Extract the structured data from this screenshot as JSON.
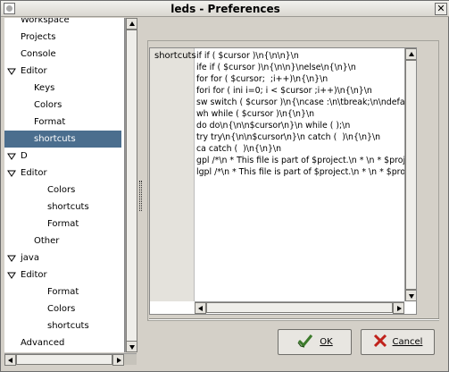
{
  "window": {
    "title": "leds - Preferences"
  },
  "tree": {
    "items": [
      {
        "label": "Workspace",
        "depth": 0,
        "expanded": null,
        "selected": false
      },
      {
        "label": "Projects",
        "depth": 1,
        "expanded": null,
        "selected": false
      },
      {
        "label": "Console",
        "depth": 1,
        "expanded": null,
        "selected": false
      },
      {
        "label": "Editor",
        "depth": 0,
        "expanded": true,
        "selected": false
      },
      {
        "label": "Keys",
        "depth": 2,
        "expanded": null,
        "selected": false
      },
      {
        "label": "Colors",
        "depth": 2,
        "expanded": null,
        "selected": false
      },
      {
        "label": "Format",
        "depth": 2,
        "expanded": null,
        "selected": false
      },
      {
        "label": "shortcuts",
        "depth": 2,
        "expanded": null,
        "selected": true
      },
      {
        "label": "D",
        "depth": 0,
        "expanded": true,
        "selected": false
      },
      {
        "label": "Editor",
        "depth": 1,
        "expanded": true,
        "selected": false
      },
      {
        "label": "Colors",
        "depth": 3,
        "expanded": null,
        "selected": false
      },
      {
        "label": "shortcuts",
        "depth": 3,
        "expanded": null,
        "selected": false
      },
      {
        "label": "Format",
        "depth": 3,
        "expanded": null,
        "selected": false
      },
      {
        "label": "Other",
        "depth": 2,
        "expanded": null,
        "selected": false
      },
      {
        "label": "java",
        "depth": 0,
        "expanded": true,
        "selected": false
      },
      {
        "label": "Editor",
        "depth": 1,
        "expanded": true,
        "selected": false
      },
      {
        "label": "Format",
        "depth": 3,
        "expanded": null,
        "selected": false
      },
      {
        "label": "Colors",
        "depth": 3,
        "expanded": null,
        "selected": false
      },
      {
        "label": "shortcuts",
        "depth": 3,
        "expanded": null,
        "selected": false
      },
      {
        "label": "Advanced",
        "depth": 1,
        "expanded": null,
        "selected": false
      }
    ]
  },
  "shortcuts": {
    "key_label": "shortcuts",
    "lines": [
      "if if ( $cursor )\\n{\\n\\n}\\n",
      "ife if ( $cursor )\\n{\\n\\n}\\nelse\\n{\\n}\\n",
      "for for ( $cursor;  ;i++)\\n{\\n}\\n",
      "fori for ( ini i=0; i < $cursor ;i++)\\n{\\n}\\n",
      "sw switch ( $cursor )\\n{\\ncase :\\n\\tbreak;\\n\\ndefault:\\n\\",
      "wh while ( $cursor )\\n{\\n}\\n",
      "do do\\n{\\n\\n$cursor\\n}\\n while ( );\\n",
      "try try\\n{\\n\\n$cursor\\n}\\n catch (  )\\n{\\n}\\n",
      "ca catch (  )\\n{\\n}\\n",
      "gpl /*\\n * This file is part of $project.\\n * \\n * $project is",
      "lgpl /*\\n * This file is part of $project.\\n * \\n * $project is"
    ]
  },
  "buttons": {
    "ok": {
      "label": "OK",
      "icon": "check-icon"
    },
    "cancel": {
      "label": "Cancel",
      "icon": "x-icon"
    }
  }
}
